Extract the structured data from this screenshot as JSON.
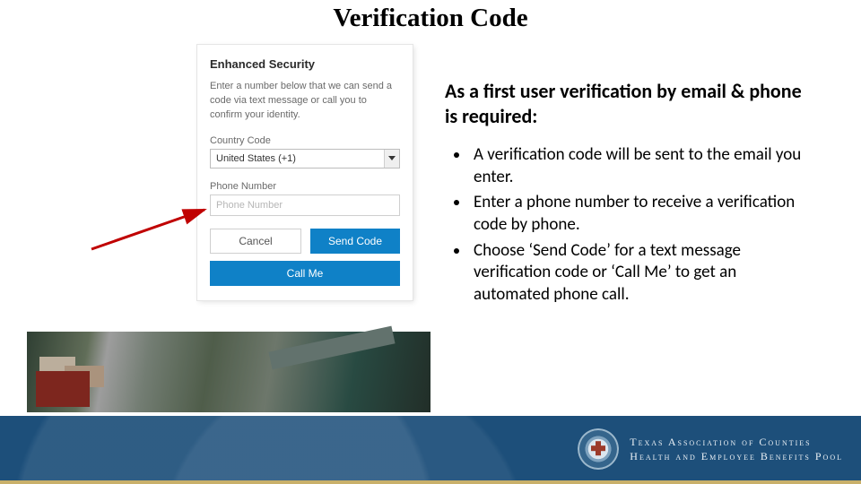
{
  "title": "Verification Code",
  "panel": {
    "heading": "Enhanced Security",
    "description": "Enter a number below that we can send a code via text message or call you to confirm your identity.",
    "country_label": "Country Code",
    "country_value": "United States (+1)",
    "phone_label": "Phone Number",
    "phone_placeholder": "Phone Number",
    "cancel_label": "Cancel",
    "send_label": "Send Code",
    "call_label": "Call Me"
  },
  "instructions": {
    "heading": "As a first user verification by email & phone is required:",
    "bullets": [
      "A verification code will be sent to the email you enter.",
      "Enter a phone number to receive a verification code by phone.",
      "Choose ‘Send Code’ for a text message verification code or ‘Call Me’ to get an automated phone call."
    ]
  },
  "brand": {
    "line1": "Texas Association of Counties",
    "line2": "Health and Employee Benefits Pool"
  }
}
